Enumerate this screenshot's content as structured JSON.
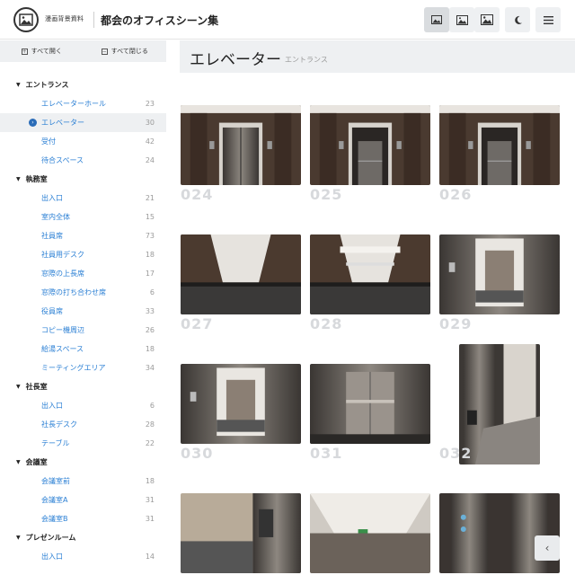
{
  "header": {
    "brand": "漫画背景資料",
    "site_title": "都会のオフィスシーン集",
    "tools": [
      {
        "icon": "image-small-icon",
        "active": true
      },
      {
        "icon": "image-medium-icon",
        "active": false
      },
      {
        "icon": "image-large-icon",
        "active": false
      },
      {
        "icon": "moon-icon",
        "active": false
      },
      {
        "icon": "menu-icon",
        "active": false
      }
    ]
  },
  "sidebar": {
    "expand_all": "すべて開く",
    "collapse_all": "すべて閉じる",
    "categories": [
      {
        "label": "エントランス",
        "items": [
          {
            "label": "エレベーターホール",
            "count": "23"
          },
          {
            "label": "エレベーター",
            "count": "30",
            "active": true
          },
          {
            "label": "受付",
            "count": "42"
          },
          {
            "label": "待合スペース",
            "count": "24"
          }
        ]
      },
      {
        "label": "執務室",
        "items": [
          {
            "label": "出入口",
            "count": "21"
          },
          {
            "label": "室内全体",
            "count": "15"
          },
          {
            "label": "社員席",
            "count": "73"
          },
          {
            "label": "社員用デスク",
            "count": "18"
          },
          {
            "label": "窓際の上長席",
            "count": "17"
          },
          {
            "label": "窓際の打ち合わせ席",
            "count": "6"
          },
          {
            "label": "役員席",
            "count": "33"
          },
          {
            "label": "コピー機周辺",
            "count": "26"
          },
          {
            "label": "給湯スペース",
            "count": "18"
          },
          {
            "label": "ミーティングエリア",
            "count": "34"
          }
        ]
      },
      {
        "label": "社長室",
        "items": [
          {
            "label": "出入口",
            "count": "6"
          },
          {
            "label": "社長デスク",
            "count": "28"
          },
          {
            "label": "テーブル",
            "count": "22"
          }
        ]
      },
      {
        "label": "会議室",
        "items": [
          {
            "label": "会議室前",
            "count": "18"
          },
          {
            "label": "会議室A",
            "count": "31"
          },
          {
            "label": "会議室B",
            "count": "31"
          }
        ]
      },
      {
        "label": "プレゼンルーム",
        "items": [
          {
            "label": "出入口",
            "count": "14"
          }
        ]
      }
    ]
  },
  "main": {
    "title": "エレベーター",
    "subtitle": "エントランス",
    "thumbnails": [
      {
        "num": "024",
        "scene": "doors-closed"
      },
      {
        "num": "025",
        "scene": "doors-open"
      },
      {
        "num": "026",
        "scene": "doors-open"
      },
      {
        "num": "027",
        "scene": "cabin-floor"
      },
      {
        "num": "028",
        "scene": "cabin-floor-lit"
      },
      {
        "num": "029",
        "scene": "cabin-exit"
      },
      {
        "num": "030",
        "scene": "cabin-door-view"
      },
      {
        "num": "031",
        "scene": "cabin-wall"
      },
      {
        "num": "032",
        "scene": "cabin-portrait"
      },
      {
        "num": "",
        "scene": "panel"
      },
      {
        "num": "",
        "scene": "ceiling"
      },
      {
        "num": "",
        "scene": "buttons"
      }
    ]
  },
  "scroll_top_icon": "chevron-left-icon"
}
